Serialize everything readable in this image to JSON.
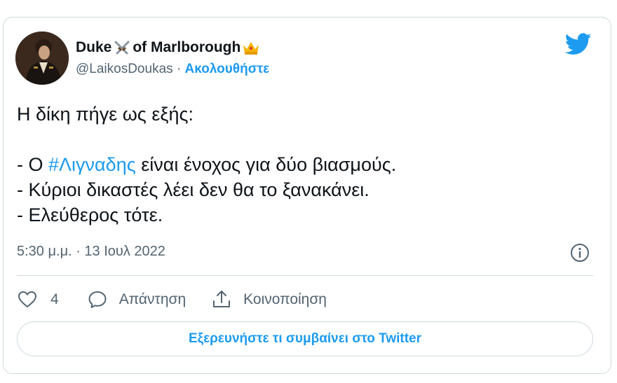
{
  "tweet": {
    "author": {
      "name_part1": "Duke",
      "name_part2": "of Marlborough",
      "name_emoji_1": "crossed-swords-icon",
      "name_emoji_2": "crown-icon",
      "handle": "@LaikosDoukas",
      "separator": " · ",
      "follow_label": "Ακολουθήστε"
    },
    "text": {
      "line1": "Η δίκη πήγε ως εξής:",
      "line2_prefix": "- Ο ",
      "hashtag": "#Λιγναδης",
      "line2_suffix": " είναι ένοχος για δύο βιασμούς.",
      "line3": "- Κύριοι δικαστές λέει δεν θα το ξανακάνει.",
      "line4": "- Ελεύθερος τότε."
    },
    "timestamp": "5:30 μ.μ. · 13 Ιουλ 2022",
    "actions": {
      "like_count": "4",
      "reply_label": "Απάντηση",
      "share_label": "Κοινοποίηση"
    },
    "cta_label": "Εξερευνήστε τι συμβαίνει στο Twitter"
  },
  "colors": {
    "accent": "#1d9bf0",
    "text": "#0f1419",
    "muted": "#536471",
    "border": "#cfd9de"
  }
}
